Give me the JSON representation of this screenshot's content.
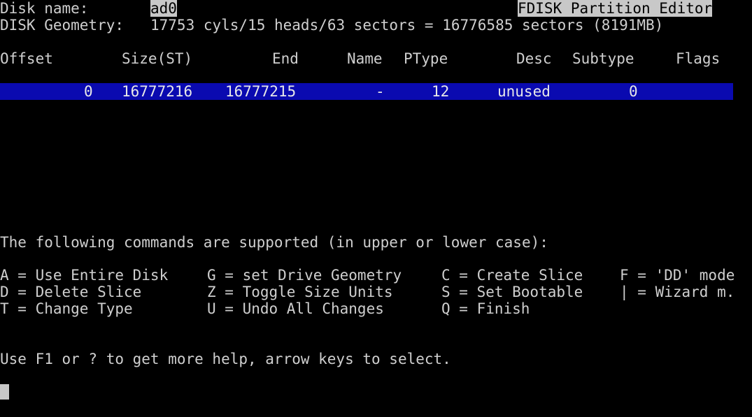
{
  "header": {
    "disk_name_label": "Disk name:",
    "disk_name_value": "ad0",
    "app_title": "FDISK Partition Editor",
    "geometry_label": "DISK Geometry:",
    "geometry_value": "17753 cyls/15 heads/63 sectors = 16776585 sectors (8191MB)"
  },
  "table": {
    "columns": [
      "Offset",
      "Size(ST)",
      "End",
      "Name",
      "PType",
      "Desc",
      "Subtype",
      "Flags"
    ],
    "rows": [
      {
        "offset": "0",
        "size": "16777216",
        "end": "16777215",
        "name": "-",
        "ptype": "12",
        "desc": "unused",
        "subtype": "0",
        "flags": ""
      }
    ]
  },
  "commands": {
    "intro": "The following commands are supported (in upper or lower case):",
    "items": [
      "A = Use Entire Disk",
      "G = set Drive Geometry",
      "C = Create Slice",
      "F = 'DD' mode",
      "D = Delete Slice",
      "Z = Toggle Size Units",
      "S = Set Bootable",
      "| = Wizard m.",
      "T = Change Type",
      "U = Undo All Changes",
      "Q = Finish"
    ]
  },
  "help_text": "Use F1 or ? to get more help, arrow keys to select.",
  "colors": {
    "background": "#000000",
    "text": "#cfcfcf",
    "selection": "#0a0ab0",
    "inverse": "#c8c8c8"
  }
}
